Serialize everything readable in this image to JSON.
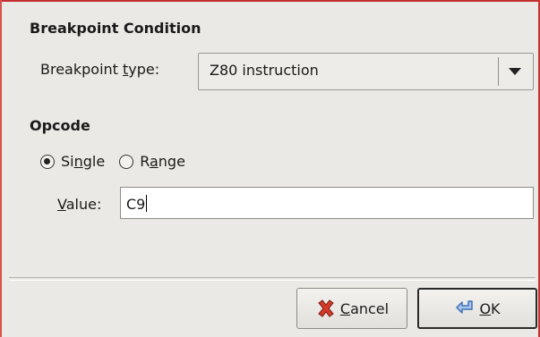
{
  "dialog": {
    "section_condition_title": "Breakpoint Condition",
    "breakpoint_type": {
      "label_prefix": "Breakpoint ",
      "label_mnemonic": "t",
      "label_suffix": "ype:",
      "selected": "Z80 instruction"
    },
    "section_opcode_title": "Opcode",
    "mode": {
      "single": {
        "prefix": "Si",
        "mnemonic": "n",
        "suffix": "gle",
        "selected": true
      },
      "range": {
        "prefix": "R",
        "mnemonic": "a",
        "suffix": "nge",
        "selected": false
      }
    },
    "value_field": {
      "label_mnemonic": "V",
      "label_rest": "alue:",
      "value": "C9"
    }
  },
  "buttons": {
    "cancel": {
      "mnemonic": "C",
      "rest": "ancel",
      "icon": "cancel-x-icon"
    },
    "ok": {
      "mnemonic": "O",
      "rest": "K",
      "icon": "ok-arrow-icon"
    }
  },
  "colors": {
    "window_border": "#c42f2f",
    "background": "#ebe9e5",
    "cancel_icon": "#d43a2a",
    "ok_icon": "#5b8fd6"
  }
}
